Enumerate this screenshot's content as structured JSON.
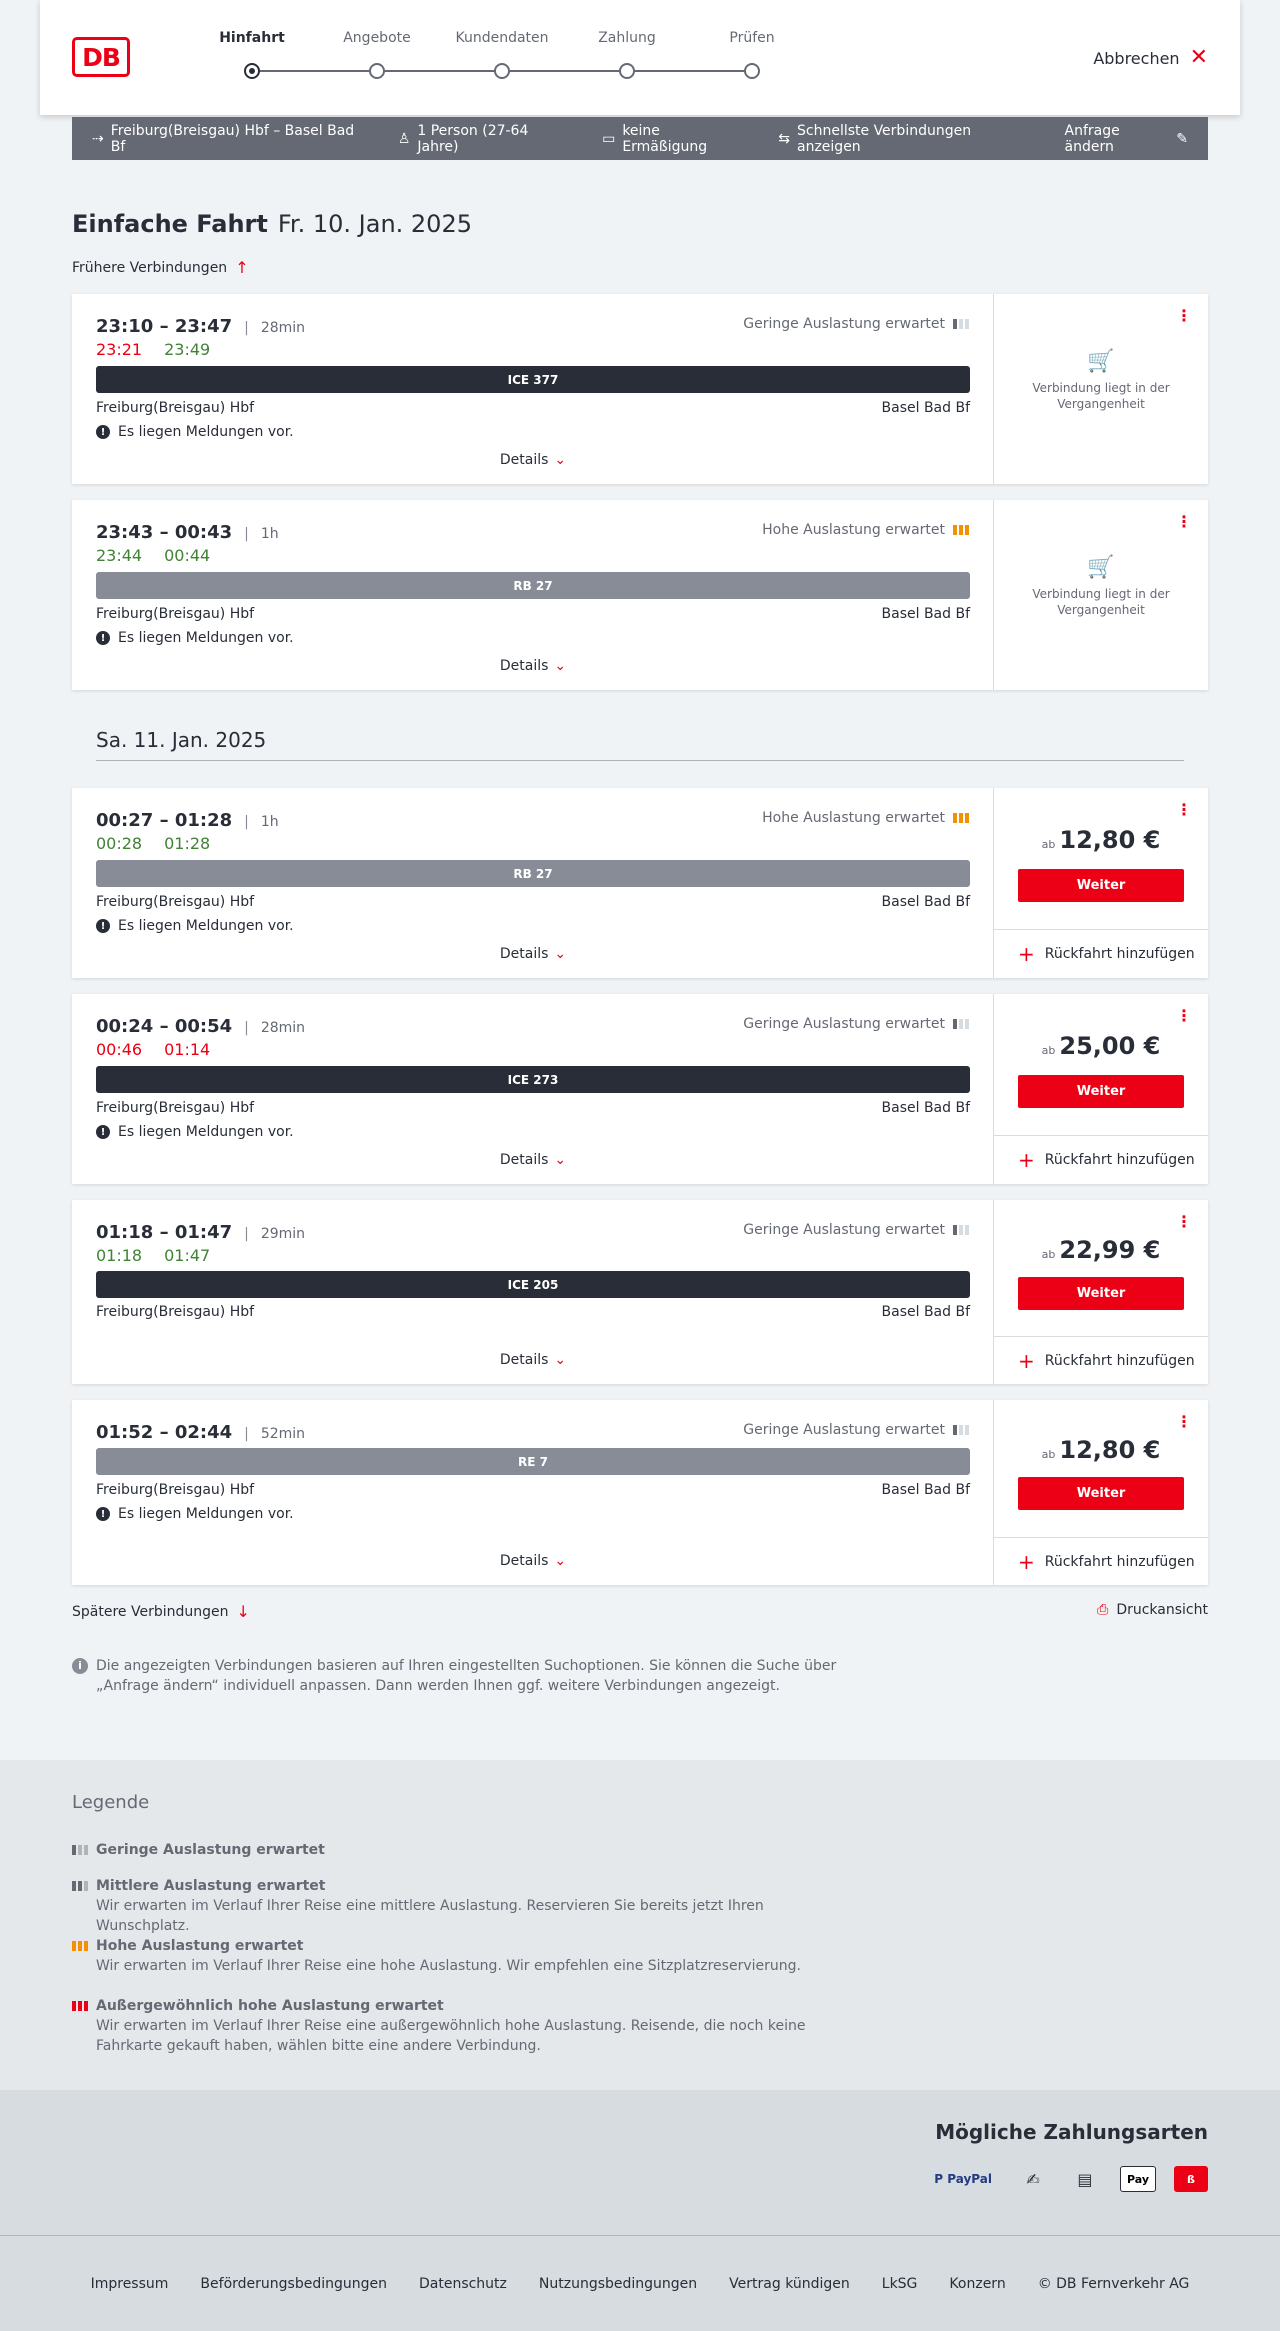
{
  "header": {
    "logo": "DB",
    "steps": [
      {
        "label": "Hinfahrt",
        "active": true
      },
      {
        "label": "Angebote",
        "active": false
      },
      {
        "label": "Kundendaten",
        "active": false
      },
      {
        "label": "Zahlung",
        "active": false
      },
      {
        "label": "Prüfen",
        "active": false
      }
    ],
    "cancel_label": "Abbrechen"
  },
  "summary": {
    "route": "Freiburg(Breisgau) Hbf – Basel Bad Bf",
    "travellers": "1 Person (27-64 Jahre)",
    "discount": "keine Ermäßigung",
    "fastest": "Schnellste Verbindungen anzeigen",
    "edit": "Anfrage ändern"
  },
  "page": {
    "title": "Einfache Fahrt",
    "date": "Fr. 10. Jan. 2025",
    "earlier": "Frühere Verbindungen",
    "day2": "Sa. 11. Jan. 2025",
    "later": "Spätere Verbindungen",
    "print": "Druckansicht",
    "info": "Die angezeigten Verbindungen basieren auf Ihren eingestellten Suchoptionen. Sie können die Suche über „Anfrage ändern“ individuell anpassen. Dann werden Ihnen ggf. weitere Verbindungen angezeigt."
  },
  "connections": [
    {
      "times": "23:10 – 23:47",
      "duration": "28min",
      "rt_dep": "23:21",
      "rt_arr": "23:49",
      "occupancy": "Geringe Auslastung erwartet",
      "train": "ICE 377",
      "from": "Freiburg(Breisgau) Hbf",
      "to": "Basel Bad Bf",
      "message": "Es liegen Meldungen vor.",
      "details": "Details",
      "past": "Verbindung liegt in der Vergangenheit"
    },
    {
      "times": "23:43 – 00:43",
      "duration": "1h",
      "rt_dep": "23:44",
      "rt_arr": "00:44",
      "occupancy": "Hohe Auslastung erwartet",
      "train": "RB 27",
      "from": "Freiburg(Breisgau) Hbf",
      "to": "Basel Bad Bf",
      "message": "Es liegen Meldungen vor.",
      "details": "Details",
      "past": "Verbindung liegt in der Vergangenheit"
    },
    {
      "times": "00:27 – 01:28",
      "duration": "1h",
      "rt_dep": "00:28",
      "rt_arr": "01:28",
      "occupancy": "Hohe Auslastung erwartet",
      "train": "RB 27",
      "from": "Freiburg(Breisgau) Hbf",
      "to": "Basel Bad Bf",
      "message": "Es liegen Meldungen vor.",
      "details": "Details",
      "price_prefix": "ab",
      "price": "12,80 €",
      "button": "Weiter",
      "return": "Rückfahrt hinzufügen"
    },
    {
      "times": "00:24 – 00:54",
      "duration": "28min",
      "rt_dep": "00:46",
      "rt_arr": "01:14",
      "occupancy": "Geringe Auslastung erwartet",
      "train": "ICE 273",
      "from": "Freiburg(Breisgau) Hbf",
      "to": "Basel Bad Bf",
      "message": "Es liegen Meldungen vor.",
      "details": "Details",
      "price_prefix": "ab",
      "price": "25,00 €",
      "button": "Weiter",
      "return": "Rückfahrt hinzufügen"
    },
    {
      "times": "01:18 – 01:47",
      "duration": "29min",
      "rt_dep": "01:18",
      "rt_arr": "01:47",
      "occupancy": "Geringe Auslastung erwartet",
      "train": "ICE 205",
      "from": "Freiburg(Breisgau) Hbf",
      "to": "Basel Bad Bf",
      "details": "Details",
      "price_prefix": "ab",
      "price": "22,99 €",
      "button": "Weiter",
      "return": "Rückfahrt hinzufügen"
    },
    {
      "times": "01:52 – 02:44",
      "duration": "52min",
      "occupancy": "Geringe Auslastung erwartet",
      "train": "RE 7",
      "from": "Freiburg(Breisgau) Hbf",
      "to": "Basel Bad Bf",
      "message": "Es liegen Meldungen vor.",
      "details": "Details",
      "price_prefix": "ab",
      "price": "12,80 €",
      "button": "Weiter",
      "return": "Rückfahrt hinzufügen"
    }
  ],
  "legend": {
    "title": "Legende",
    "items": [
      {
        "title": "Geringe Auslastung erwartet",
        "desc": ""
      },
      {
        "title": "Mittlere Auslastung erwartet",
        "desc": "Wir erwarten im Verlauf Ihrer Reise eine mittlere Auslastung. Reservieren Sie bereits jetzt Ihren Wunschplatz."
      },
      {
        "title": "Hohe Auslastung erwartet",
        "desc": "Wir erwarten im Verlauf Ihrer Reise eine hohe Auslastung. Wir empfehlen eine Sitzplatzreservierung."
      },
      {
        "title": "Außergewöhnlich hohe Auslastung erwartet",
        "desc": "Wir erwarten im Verlauf Ihrer Reise eine außergewöhnlich hohe Auslastung. Reisende, die noch keine Fahrkarte gekauft haben, wählen bitte eine andere Verbindung."
      }
    ]
  },
  "payments": {
    "title": "Mögliche Zahlungsarten",
    "paypal": "P PayPal",
    "apple": " Pay"
  },
  "footer": [
    "Impressum",
    "Beförderungsbedingungen",
    "Datenschutz",
    "Nutzungsbedingungen",
    "Vertrag kündigen",
    "LkSG",
    "Konzern",
    "© DB Fernverkehr AG"
  ],
  "colors": {
    "db_red": "#ec0016",
    "late": "#ec0016",
    "on_time": "#408335",
    "high_occupancy": "#f39200"
  }
}
